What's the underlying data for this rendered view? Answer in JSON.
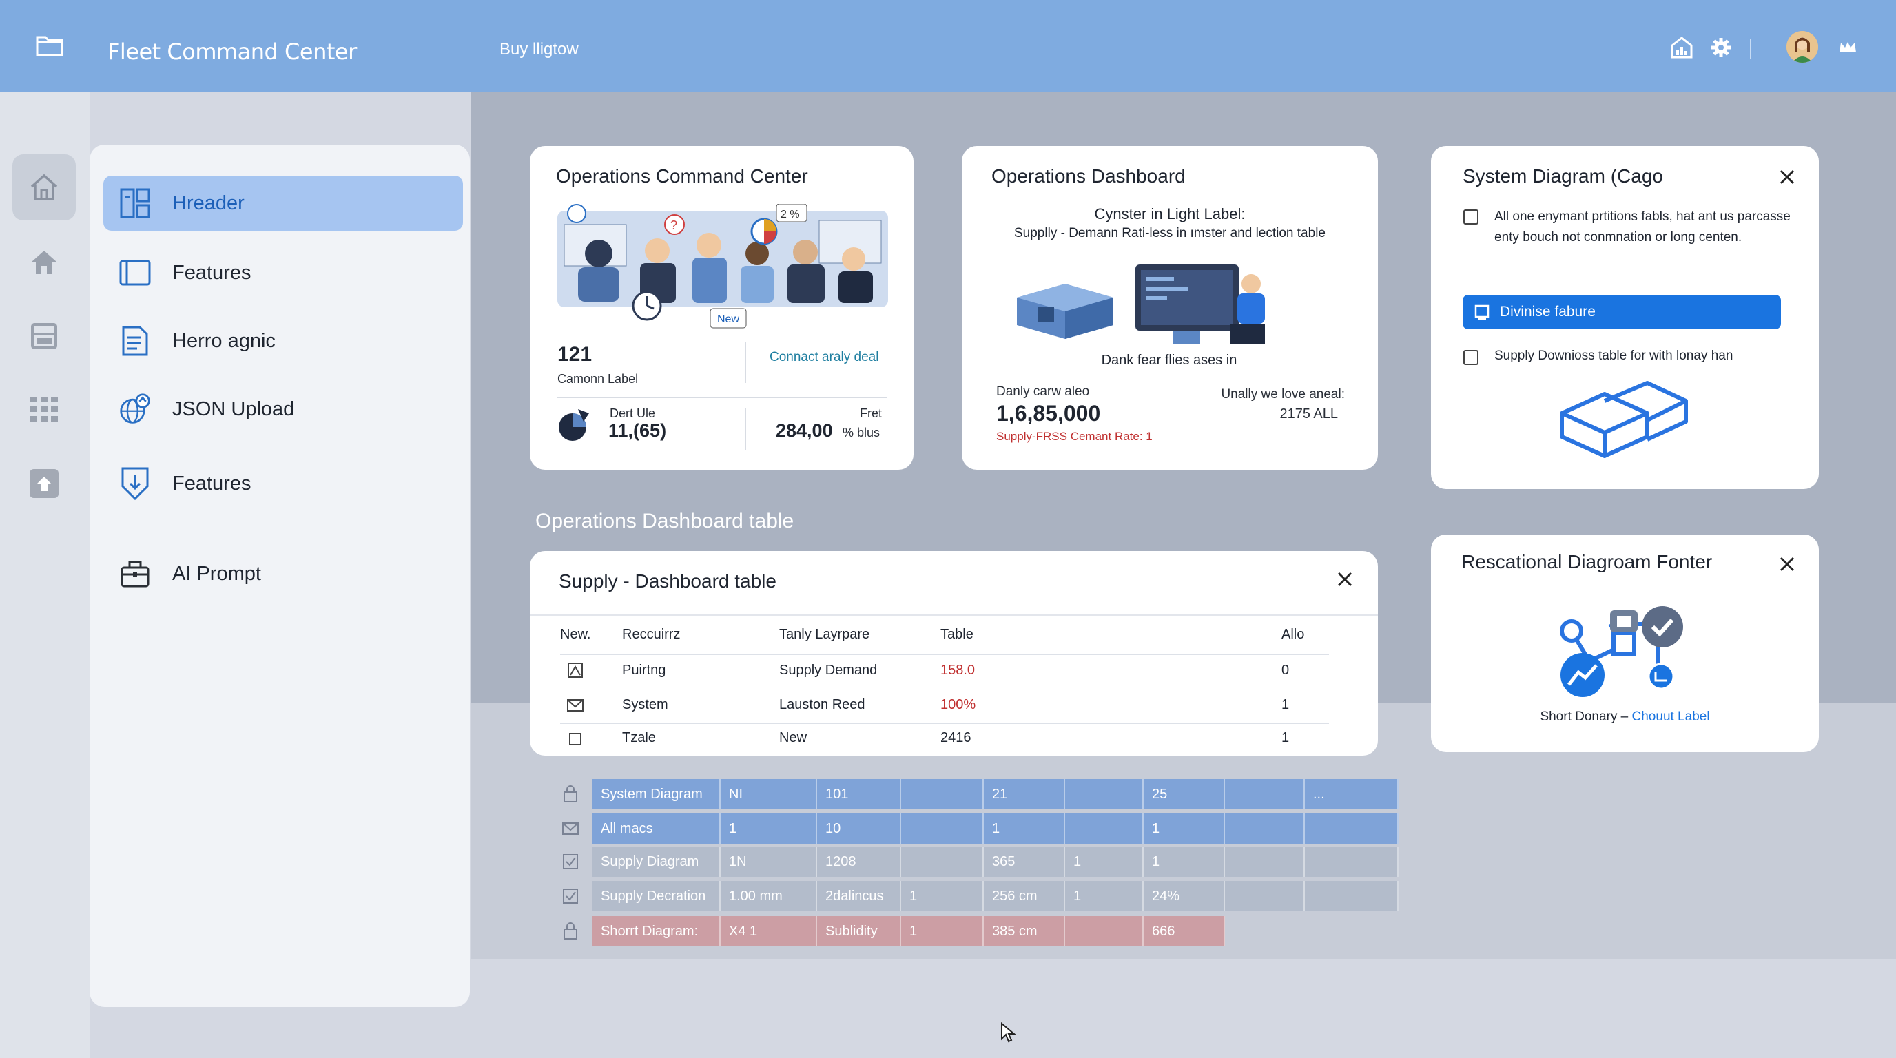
{
  "app": {
    "title": "Fleet Command Center",
    "top_link": "Buy lligtow"
  },
  "topbar_icons": [
    "chart-house-icon",
    "gear-icon",
    "avatar",
    "crown-icon"
  ],
  "rail": [
    "home-icon",
    "house-icon",
    "archive-icon",
    "grid-icon",
    "upload-icon"
  ],
  "sidebar": {
    "items": [
      {
        "label": "Hreader",
        "icon": "layout-icon",
        "active": true
      },
      {
        "label": "Features",
        "icon": "panel-icon",
        "active": false
      },
      {
        "label": "Herro agnic",
        "icon": "document-icon",
        "active": false
      },
      {
        "label": "JSON Upload",
        "icon": "globe-upload-icon",
        "active": false
      },
      {
        "label": "Features",
        "icon": "shield-download-icon",
        "active": false
      },
      {
        "label": "AI Prompt",
        "icon": "briefcase-icon",
        "active": false
      }
    ]
  },
  "card_ops_center": {
    "title": "Operations Command Center",
    "badge_new": "New",
    "badge_pct": "2 %",
    "stat_value": "121",
    "stat_label": "Camonn Label",
    "link": "Connact araly deal",
    "bottom_left_label": "Dert Ule",
    "bottom_left_value": "11,(65)",
    "bottom_right_label": "Fret",
    "bottom_right_value": "284,00",
    "bottom_right_unit": "% blus"
  },
  "card_ops_dashboard": {
    "title": "Operations Dashboard",
    "headline": "Cynster in Light Label:",
    "subline": "Supplly - Demann Rati-less in ımster and lection table",
    "caption": "Dank fear flies ases in",
    "left_label": "Danly carw aleo",
    "left_value": "1,6,85,000",
    "red_note": "Supply-FRSS Cemant Rate: 1",
    "right_label": "Unally we love aneal:",
    "right_value": "2175 ALL"
  },
  "card_system_diagram": {
    "title": "System Diagram (Cago",
    "check1": "All one enymant prtitions fabls, hat ant us parcasse enty bouch not conmnation or long centen.",
    "button": "Divinise fabure",
    "check2": "Supply Downioss table for with lonay han"
  },
  "card_relational": {
    "title": "Rescational Diagroam Fonter",
    "caption_left": "Short Donary –",
    "caption_link": "Chouut Label"
  },
  "section_label": "Operations Dashboard table",
  "table": {
    "title": "Supply - Dashboard table",
    "headers": [
      "New.",
      "Reccuirrz",
      "Tanly Layrpare",
      "Table",
      "Allo"
    ],
    "rows": [
      {
        "icon": "image-icon",
        "c1": "Puirtng",
        "c2": "Supply Demand",
        "c3": "158.0",
        "c4": "0",
        "red": true
      },
      {
        "icon": "mail-icon",
        "c1": "System",
        "c2": "Lauston Reed",
        "c3": "100%",
        "c4": "1",
        "red": true
      },
      {
        "icon": "square-icon",
        "c1": "Tzale",
        "c2": "New",
        "c3": "2416",
        "c4": "1",
        "red": false
      }
    ]
  },
  "grid": {
    "colors": {
      "blue": "#7fa3d8",
      "grey": "#b3bccb",
      "red": "#cc9ea4"
    },
    "rows": [
      {
        "icon": "lock-icon",
        "style": "blue",
        "cells": [
          "System Diagram",
          "NI",
          "101",
          "",
          "21",
          "",
          "25",
          "",
          "..."
        ]
      },
      {
        "icon": "envelope-icon",
        "style": "blue",
        "cells": [
          "All macs",
          "1",
          "10",
          "",
          "1",
          "",
          "1",
          "",
          ""
        ]
      },
      {
        "icon": "check-icon",
        "style": "grey",
        "cells": [
          "Supply Diagram",
          "1N",
          "1208",
          "",
          "365",
          "1",
          "1",
          "",
          ""
        ]
      },
      {
        "icon": "check-icon",
        "style": "grey",
        "cells": [
          "Supply Decration",
          "1.00 mm",
          "2dalincus",
          "1",
          "256 cm",
          "1",
          "24%",
          "",
          ""
        ]
      },
      {
        "icon": "lock-icon",
        "style": "red",
        "cells": [
          "Shorrt Diagram:",
          "X4 1",
          "Sublidity",
          "1",
          "385 cm",
          "",
          "666"
        ]
      }
    ]
  }
}
